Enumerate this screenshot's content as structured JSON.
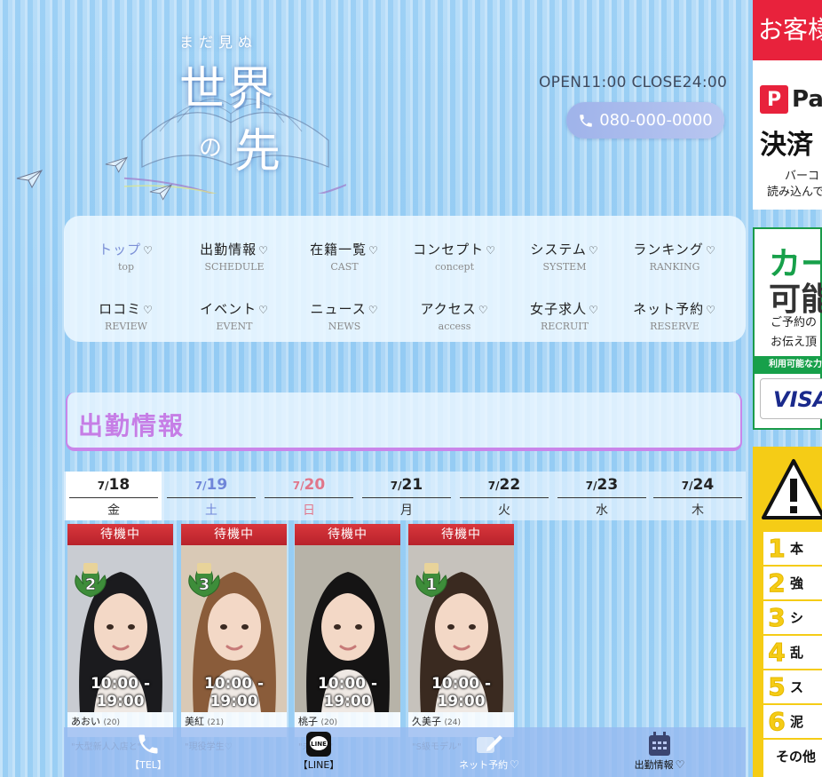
{
  "logo": {
    "sub": "まだ見ぬ",
    "main1": "世界",
    "no": "の",
    "main2": "先"
  },
  "header": {
    "hours": "OPEN11:00 CLOSE24:00",
    "tel": "080-000-0000"
  },
  "nav": [
    {
      "jp": "トップ",
      "en": "top",
      "active": true
    },
    {
      "jp": "出勤情報",
      "en": "SCHEDULE"
    },
    {
      "jp": "在籍一覧",
      "en": "CAST"
    },
    {
      "jp": "コンセプト",
      "en": "concept"
    },
    {
      "jp": "システム",
      "en": "SYSTEM"
    },
    {
      "jp": "ランキング",
      "en": "RANKING"
    },
    {
      "jp": "ロコミ",
      "en": "REVIEW"
    },
    {
      "jp": "イベント",
      "en": "EVENT"
    },
    {
      "jp": "ニュース",
      "en": "NEWS"
    },
    {
      "jp": "アクセス",
      "en": "access"
    },
    {
      "jp": "女子求人",
      "en": "RECRUIT"
    },
    {
      "jp": "ネット予約",
      "en": "RESERVE"
    }
  ],
  "section": {
    "title": "出勤情報"
  },
  "days": [
    {
      "m": "7/",
      "d": "18",
      "w": "金",
      "type": "sel"
    },
    {
      "m": "7/",
      "d": "19",
      "w": "土",
      "type": "sat"
    },
    {
      "m": "7/",
      "d": "20",
      "w": "日",
      "type": "sun"
    },
    {
      "m": "7/",
      "d": "21",
      "w": "月",
      "type": ""
    },
    {
      "m": "7/",
      "d": "22",
      "w": "火",
      "type": ""
    },
    {
      "m": "7/",
      "d": "23",
      "w": "水",
      "type": ""
    },
    {
      "m": "7/",
      "d": "24",
      "w": "木",
      "type": ""
    }
  ],
  "cards": [
    {
      "status": "待機中",
      "rank": "2",
      "time": "10:00 - 19:00",
      "name": "あおい",
      "age": "(20)",
      "desc": "\"大型新人入店と\"",
      "hair": "#1b1b1e",
      "bg": "#c9ccd2"
    },
    {
      "status": "待機中",
      "rank": "3",
      "time": "10:00 - 19:00",
      "name": "美紅",
      "age": "(21)",
      "desc": "\"現役学生♡",
      "hair": "#8a5c3a",
      "bg": "#d9c9b6"
    },
    {
      "status": "待機中",
      "rank": "",
      "time": "10:00 - 19:00",
      "name": "桃子",
      "age": "(20)",
      "desc": "\"未経験\"",
      "hair": "#151414",
      "bg": "#b7b3a8"
    },
    {
      "status": "待機中",
      "rank": "1",
      "time": "10:00 - 19:00",
      "name": "久美子",
      "age": "(24)",
      "desc": "\"S級モデル\"",
      "hair": "#3a2a20",
      "bg": "#c6c2bc"
    }
  ],
  "bottombar": [
    {
      "label": "【TEL】",
      "icon": "phone-icon"
    },
    {
      "label": "【LINE】",
      "icon": "line-icon"
    },
    {
      "label": "ネット予約",
      "icon": "edit-icon"
    },
    {
      "label": "出勤情報",
      "icon": "calendar-icon"
    }
  ],
  "banners": {
    "b1": {
      "head": "お客様",
      "pay_p": "P",
      "pay_text": "Pa",
      "kessai": "決済",
      "barcode": "バーコ",
      "yomi": "読み込んで"
    },
    "b2": {
      "ka": "カー",
      "ka2": "可能",
      "t1": "ご予約の",
      "t2": "お伝え頂",
      "green": "利用可能な力",
      "visa": "VISA"
    },
    "b3": {
      "rows": [
        {
          "n": "1",
          "t": "本"
        },
        {
          "n": "2",
          "t": "強"
        },
        {
          "n": "3",
          "t": "シ"
        },
        {
          "n": "4",
          "t": "乱"
        },
        {
          "n": "5",
          "t": "ス"
        },
        {
          "n": "6",
          "t": "泥"
        }
      ],
      "other": "その他"
    }
  },
  "colors": {
    "accent": "#c67ee6",
    "status": "#d9363c",
    "nav_active": "#7b8fd6"
  }
}
